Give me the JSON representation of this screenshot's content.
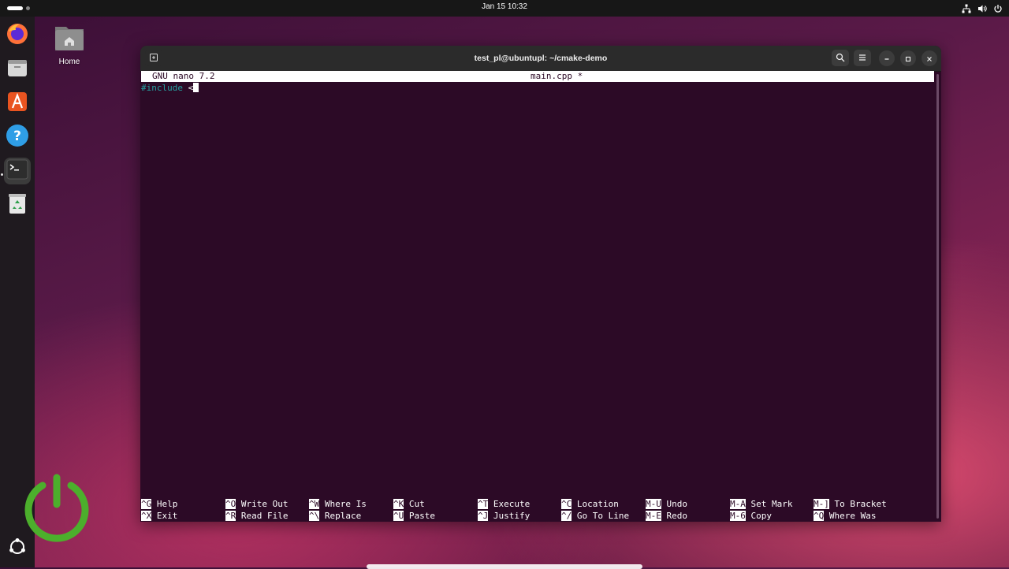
{
  "topbar": {
    "clock": "Jan 15  10:32",
    "status_icons": [
      "network-icon",
      "volume-icon",
      "power-icon"
    ]
  },
  "dock": {
    "items": [
      {
        "name": "firefox-icon",
        "active": false,
        "running": false
      },
      {
        "name": "files-icon",
        "active": false,
        "running": false
      },
      {
        "name": "app-center-icon",
        "active": false,
        "running": false
      },
      {
        "name": "help-icon",
        "active": false,
        "running": false
      },
      {
        "name": "terminal-icon",
        "active": true,
        "running": true
      },
      {
        "name": "trash-icon",
        "active": false,
        "running": false
      }
    ],
    "show_apps": "ubuntu-logo-icon"
  },
  "desktop": {
    "home_label": "Home"
  },
  "window": {
    "title": "test_pl@ubuntupl: ~/cmake-demo"
  },
  "nano": {
    "version": "GNU nano 7.2",
    "filename": "main.cpp *",
    "line1_directive": "#include",
    "line1_rest": " <",
    "shortcuts_row1": [
      {
        "key": "^G",
        "label": "Help"
      },
      {
        "key": "^O",
        "label": "Write Out"
      },
      {
        "key": "^W",
        "label": "Where Is"
      },
      {
        "key": "^K",
        "label": "Cut"
      },
      {
        "key": "^T",
        "label": "Execute"
      },
      {
        "key": "^C",
        "label": "Location"
      },
      {
        "key": "M-U",
        "label": "Undo"
      },
      {
        "key": "M-A",
        "label": "Set Mark"
      },
      {
        "key": "M-]",
        "label": "To Bracket"
      }
    ],
    "shortcuts_row2": [
      {
        "key": "^X",
        "label": "Exit"
      },
      {
        "key": "^R",
        "label": "Read File"
      },
      {
        "key": "^\\",
        "label": "Replace"
      },
      {
        "key": "^U",
        "label": "Paste"
      },
      {
        "key": "^J",
        "label": "Justify"
      },
      {
        "key": "^/",
        "label": "Go To Line"
      },
      {
        "key": "M-E",
        "label": "Redo"
      },
      {
        "key": "M-6",
        "label": "Copy"
      },
      {
        "key": "^Q",
        "label": "Where Was"
      }
    ]
  },
  "colors": {
    "terminal_bg": "#2c0a26",
    "preprocessor": "#26a0a0",
    "topbar": "#171717"
  }
}
